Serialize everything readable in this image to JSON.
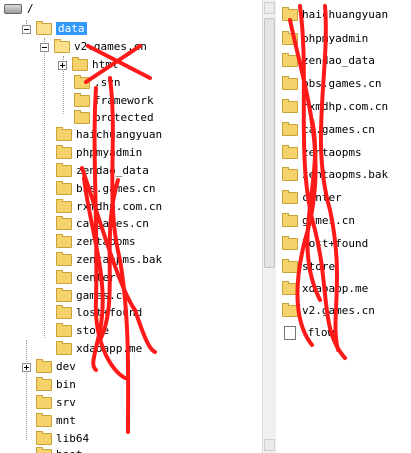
{
  "tree": {
    "root_label": "/",
    "selected_label": "data",
    "items": [
      {
        "label": "v2.games.cn"
      },
      {
        "label": "html"
      },
      {
        "label": ".svn"
      },
      {
        "label": "framework"
      },
      {
        "label": "protected"
      },
      {
        "label": "haichuangyuan"
      },
      {
        "label": "phpmyadmin"
      },
      {
        "label": "zendao_data"
      },
      {
        "label": "bbs.games.cn"
      },
      {
        "label": "rxmdhp.com.cn"
      },
      {
        "label": "ca.games.cn"
      },
      {
        "label": "zentaopms"
      },
      {
        "label": "zentaopms.bak"
      },
      {
        "label": "center"
      },
      {
        "label": "games.cn"
      },
      {
        "label": "lost+found"
      },
      {
        "label": "store"
      },
      {
        "label": "xdaoapp.me"
      },
      {
        "label": "dev"
      },
      {
        "label": "bin"
      },
      {
        "label": "srv"
      },
      {
        "label": "mnt"
      },
      {
        "label": "lib64"
      },
      {
        "label": "boot"
      }
    ]
  },
  "list": {
    "items": [
      {
        "label": "haichuangyuan"
      },
      {
        "label": "phpmyadmin"
      },
      {
        "label": "zendao_data"
      },
      {
        "label": "bbs.games.cn"
      },
      {
        "label": "rxmdhp.com.cn"
      },
      {
        "label": "ca.games.cn"
      },
      {
        "label": "zentaopms"
      },
      {
        "label": "zentaopms.bak"
      },
      {
        "label": "center"
      },
      {
        "label": "games.cn"
      },
      {
        "label": "lost+found"
      },
      {
        "label": "store"
      },
      {
        "label": "xdaoapp.me"
      },
      {
        "label": "v2.games.cn"
      },
      {
        "label": ".flow"
      }
    ]
  },
  "colors": {
    "selection": "#3399ff",
    "folder": "#f5d36a",
    "scribble": "#ff1a1a"
  }
}
